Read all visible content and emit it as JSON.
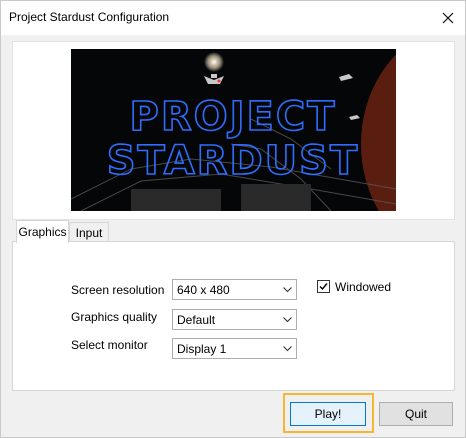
{
  "window": {
    "title": "Project Stardust Configuration"
  },
  "banner": {
    "line1": "PROJECT",
    "line2": "STARDUST",
    "colors": {
      "text_outline": "#2f6dff",
      "planet": "#c1502a"
    }
  },
  "tabs": [
    {
      "label": "Graphics",
      "active": true
    },
    {
      "label": "Input",
      "active": false
    }
  ],
  "graphics": {
    "screen_resolution": {
      "label": "Screen resolution",
      "value": "640 x 480"
    },
    "graphics_quality": {
      "label": "Graphics quality",
      "value": "Default"
    },
    "select_monitor": {
      "label": "Select monitor",
      "value": "Display 1"
    },
    "windowed": {
      "label": "Windowed",
      "checked": true
    }
  },
  "buttons": {
    "play": "Play!",
    "quit": "Quit"
  },
  "colors": {
    "highlight": "#f5b731",
    "default_button_border": "#0078d7"
  }
}
